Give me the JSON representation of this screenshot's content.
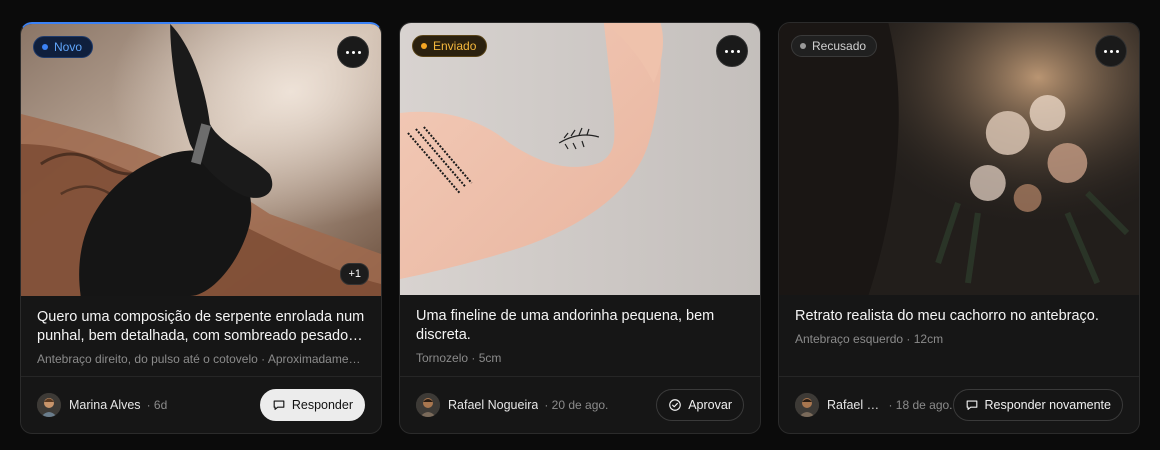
{
  "cards": [
    {
      "status": "Novo",
      "extra_count": "+1",
      "title": "Quero uma composição de serpente enrolada num punhal, bem detalhada, com sombreado pesado e...",
      "meta": "Antebraço direito, do pulso até o cotovelo · Aproximadamente ...",
      "author": "Marina Alves",
      "time": "· 6d",
      "action_label": "Responder",
      "action_icon": "chat-icon",
      "status_color": "#3b82f6"
    },
    {
      "status": "Enviado",
      "title": "Uma fineline de uma andorinha pequena, bem discreta.",
      "meta": "Tornozelo · 5cm",
      "author": "Rafael Nogueira",
      "time": "· 20 de ago.",
      "action_label": "Aprovar",
      "action_icon": "check-circle-icon",
      "status_color": "#f5a623"
    },
    {
      "status": "Recusado",
      "title": "Retrato realista do meu cachorro no antebraço.",
      "meta": "Antebraço esquerdo · 12cm",
      "author": "Rafael No...",
      "time": "· 18 de ago.",
      "action_label": "Responder novamente",
      "action_icon": "chat-icon",
      "status_color": "#9a9a9a"
    }
  ]
}
